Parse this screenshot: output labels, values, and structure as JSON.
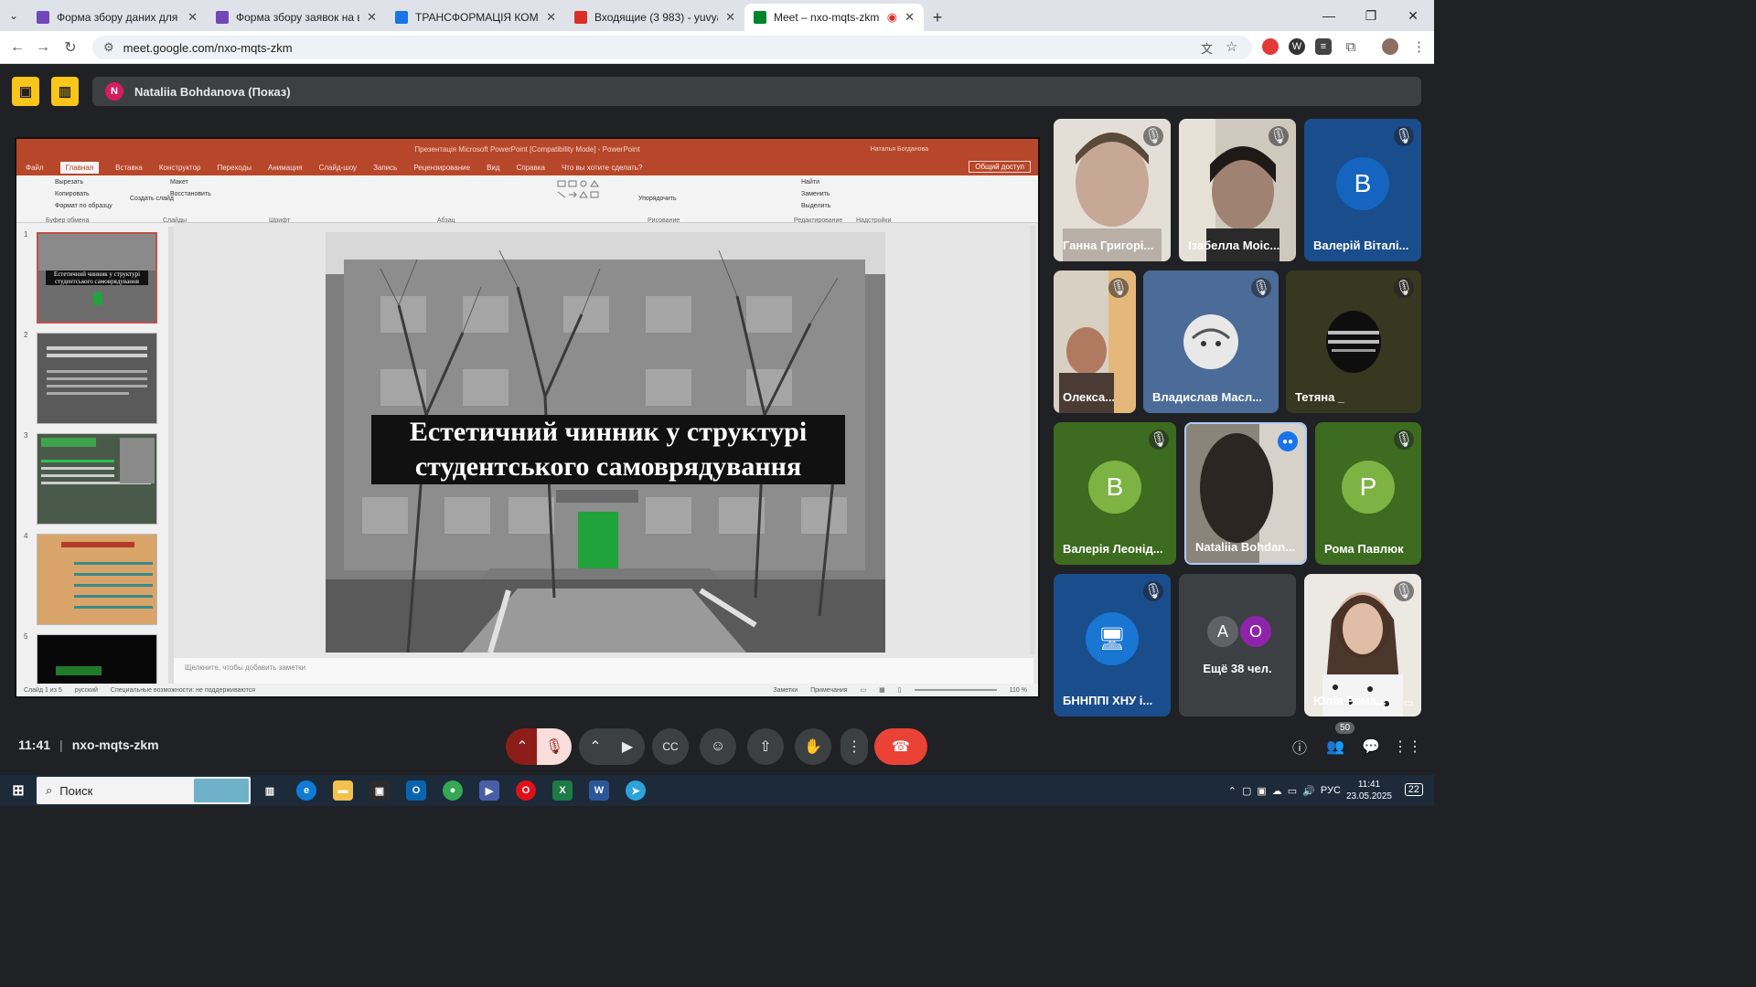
{
  "browser": {
    "tabs": [
      {
        "title": "Форма збору даних для реєст",
        "color": "#7248b9"
      },
      {
        "title": "Форма збору заявок на вступ",
        "color": "#7248b9"
      },
      {
        "title": "ТРАНСФОРМАЦІЯ КОМУНІКАЦ",
        "color": "#1a73e8"
      },
      {
        "title": "Входящие (3 983) - yuvyak@gr",
        "color": "#d93025"
      },
      {
        "title": "Meet – nxo-mqts-zkm",
        "color": "#00832d"
      }
    ],
    "url": "meet.google.com/nxo-mqts-zkm"
  },
  "meet": {
    "presenter_label": "Nataliia Bohdanova (Показ)",
    "presenter_initial": "N",
    "time": "11:41",
    "meeting_code": "nxo-mqts-zkm",
    "participants_count": "50",
    "participants": [
      {
        "name": "Ганна Григорі...",
        "type": "video"
      },
      {
        "name": "Ізабелла Моіс...",
        "type": "video"
      },
      {
        "name": "Валерій Віталі...",
        "type": "initial",
        "initial": "B",
        "color": "#1565c0"
      },
      {
        "name": "Олекса...",
        "type": "video"
      },
      {
        "name": "Владислав Масл...",
        "type": "photo"
      },
      {
        "name": "Тетяна _",
        "type": "photo"
      },
      {
        "name": "Валерія Леонід...",
        "type": "initial",
        "initial": "B",
        "color": "#7cb342"
      },
      {
        "name": "Nataliia Bohdan...",
        "type": "video"
      },
      {
        "name": "Рома Павлюк",
        "type": "initial",
        "initial": "P",
        "color": "#7cb342"
      },
      {
        "name": "БННППІ ХНУ і...",
        "type": "computer"
      },
      {
        "name": "Ещё 38 чел.",
        "type": "more",
        "initials": [
          "A",
          "O"
        ]
      },
      {
        "name": "Юлія Рома...",
        "type": "video"
      }
    ]
  },
  "powerpoint": {
    "title_bar": "Презентація Microsoft PowerPoint [Compatibility Mode] - PowerPoint",
    "user": "Наталья Богданова",
    "tabs": [
      "Файл",
      "Главная",
      "Вставка",
      "Конструктор",
      "Переходы",
      "Анимация",
      "Слайд-шоу",
      "Запись",
      "Рецензирование",
      "Вид",
      "Справка",
      "Что вы хотите сделать?"
    ],
    "share": "Общий доступ",
    "ribbon": {
      "clipboard": [
        "Вырезать",
        "Копировать",
        "Формат по образцу"
      ],
      "clipboard_group": "Буфер обмена",
      "slides": [
        "Создать слайд",
        "Макет",
        "Восстановить"
      ],
      "slides_group": "Слайды",
      "font_group": "Шрифт",
      "paragraph_group": "Абзац",
      "drawing_group": "Рисование",
      "arrange": "Упорядочить",
      "editing": [
        "Найти",
        "Заменить",
        "Выделить"
      ],
      "editing_group": "Редактирование",
      "addins_group": "Надстройки"
    },
    "slide_title": "Естетичний чинник у структурі студентського самоврядування",
    "thumb_numbers": [
      "1",
      "2",
      "3",
      "4",
      "5"
    ],
    "notes_placeholder": "Щелкните, чтобы добавить заметки",
    "status_left": "Слайд 1 из 5",
    "status_lang": "русский",
    "status_access": "Специальные возможности: не поддерживаются",
    "status_notes": "Заметки",
    "status_comments": "Примечания",
    "zoom": "110 %"
  },
  "taskbar": {
    "search_placeholder": "Поиск",
    "lang": "РУС",
    "time": "11:41",
    "date": "23.05.2025",
    "notif": "22"
  }
}
